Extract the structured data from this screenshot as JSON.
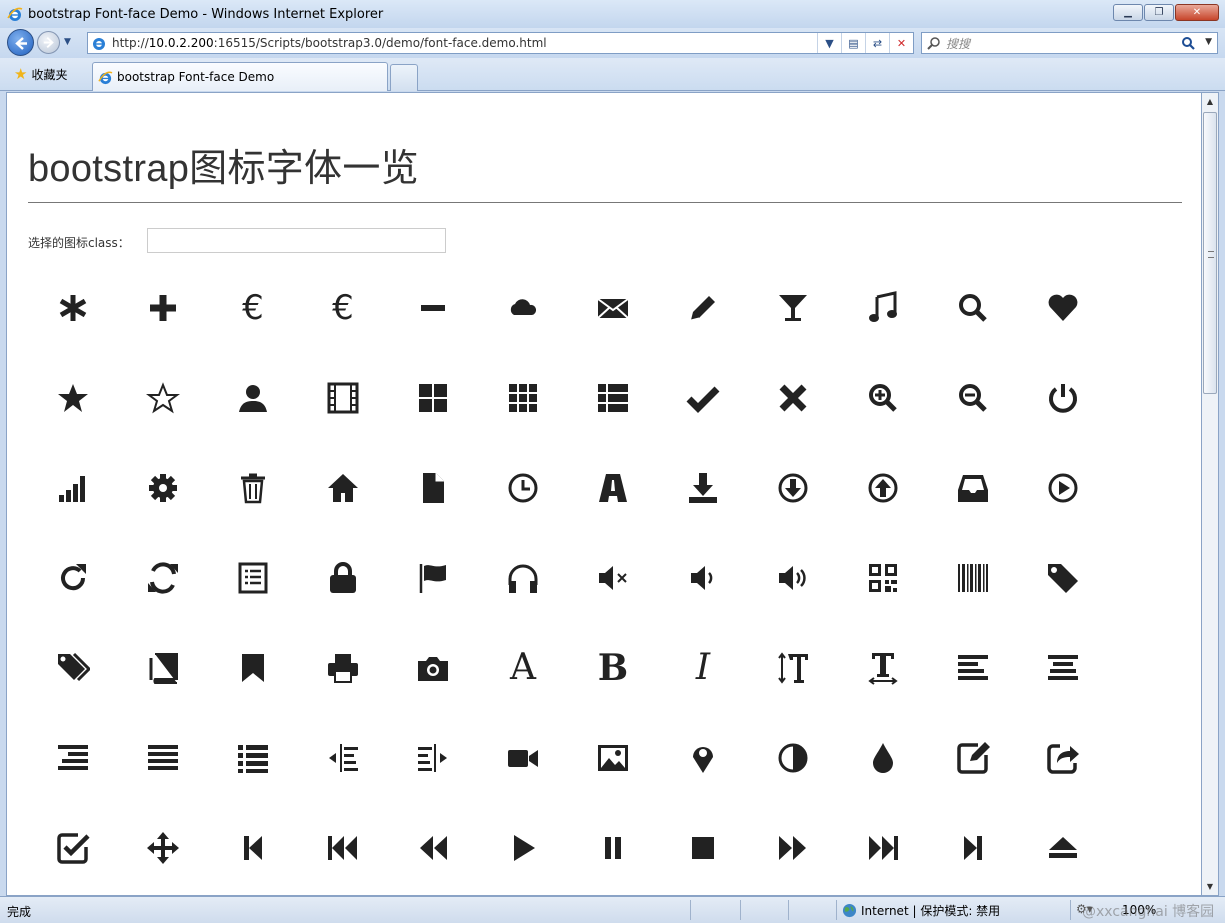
{
  "window": {
    "title": "bootstrap Font-face Demo - Windows Internet Explorer"
  },
  "toolbar": {
    "url_prefix": "http://",
    "url_host": "10.0.2.200",
    "url_rest": ":16515/Scripts/bootstrap3.0/demo/font-face.demo.html",
    "search_placeholder": "搜搜"
  },
  "tabs": {
    "favorites_label": "收藏夹",
    "active_tab": "bootstrap Font-face Demo"
  },
  "page": {
    "title": "bootstrap图标字体一览",
    "select_label": "选择的图标class：",
    "select_value": ""
  },
  "icons": [
    [
      "asterisk-icon",
      "plus-icon",
      "euro-icon",
      "euro-icon",
      "minus-icon",
      "cloud-icon",
      "envelope-icon",
      "pencil-icon",
      "glass-icon",
      "music-icon",
      "search-icon",
      "heart-icon"
    ],
    [
      "star-icon",
      "star-empty-icon",
      "user-icon",
      "film-icon",
      "th-large-icon",
      "th-icon",
      "th-list-icon",
      "ok-icon",
      "remove-icon",
      "zoom-in-icon",
      "zoom-out-icon",
      "off-icon"
    ],
    [
      "signal-icon",
      "cog-icon",
      "trash-icon",
      "home-icon",
      "file-icon",
      "time-icon",
      "road-icon",
      "download-alt-icon",
      "download-icon",
      "upload-icon",
      "inbox-icon",
      "play-circle-icon"
    ],
    [
      "repeat-icon",
      "refresh-icon",
      "list-alt-icon",
      "lock-icon",
      "flag-icon",
      "headphones-icon",
      "volume-off-icon",
      "volume-down-icon",
      "volume-up-icon",
      "qrcode-icon",
      "barcode-icon",
      "tag-icon"
    ],
    [
      "tags-icon",
      "book-icon",
      "bookmark-icon",
      "print-icon",
      "camera-icon",
      "font-icon",
      "bold-icon",
      "italic-icon",
      "text-height-icon",
      "text-width-icon",
      "align-left-icon",
      "align-center-icon"
    ],
    [
      "align-right-icon",
      "align-justify-icon",
      "list-icon",
      "indent-left-icon",
      "indent-right-icon",
      "facetime-video-icon",
      "picture-icon",
      "map-marker-icon",
      "adjust-icon",
      "tint-icon",
      "edit-icon",
      "share-icon"
    ],
    [
      "check-icon",
      "move-icon",
      "step-backward-icon",
      "fast-backward-icon",
      "backward-icon",
      "play-icon",
      "pause-icon",
      "stop-icon",
      "forward-icon",
      "fast-forward-icon",
      "step-forward-icon",
      "eject-icon"
    ]
  ],
  "glyph_text": {
    "euro": "€",
    "font": "A",
    "bold": "B",
    "italic": "I"
  },
  "statusbar": {
    "status": "完成",
    "zone": "Internet | 保护模式: 禁用",
    "zoom": "100%",
    "watermark": "@xxcanghai 博客园"
  },
  "colors": {
    "icon": "#222222",
    "title_text": "#333333",
    "chrome_blue": "#c9d9ee"
  }
}
